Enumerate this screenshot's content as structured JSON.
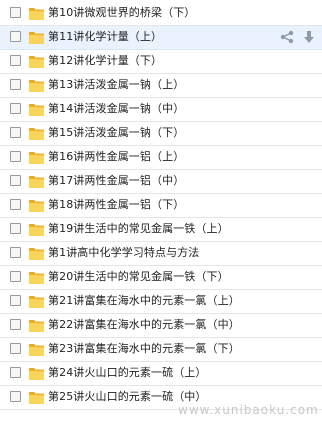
{
  "items": [
    {
      "label": "第10讲微观世界的桥梁（下）"
    },
    {
      "label": "第11讲化学计量（上）"
    },
    {
      "label": "第12讲化学计量（下）"
    },
    {
      "label": "第13讲活泼金属一钠（上）"
    },
    {
      "label": "第14讲活泼金属一钠（中）"
    },
    {
      "label": "第15讲活泼金属一钠（下）"
    },
    {
      "label": "第16讲两性金属一铝（上）"
    },
    {
      "label": "第17讲两性金属一铝（中）"
    },
    {
      "label": "第18讲两性金属一铝（下）"
    },
    {
      "label": "第19讲生活中的常见金属一铁（上）"
    },
    {
      "label": "第1讲高中化学学习特点与方法"
    },
    {
      "label": "第20讲生活中的常见金属一铁（下）"
    },
    {
      "label": "第21讲富集在海水中的元素一氯（上）"
    },
    {
      "label": "第22讲富集在海水中的元素一氯（中）"
    },
    {
      "label": "第23讲富集在海水中的元素一氯（下）"
    },
    {
      "label": "第24讲火山口的元素一硫（上）"
    },
    {
      "label": "第25讲火山口的元素一硫（中）"
    }
  ],
  "hover_row_index": 1,
  "icons": {
    "item": "folder-icon",
    "share": "share-icon",
    "download": "download-icon"
  },
  "colors": {
    "folder": "#f5c342",
    "hover_bg": "#eaf3fd",
    "action_icon": "#8e9aa6"
  },
  "watermark": "www.xunibaoku.com"
}
